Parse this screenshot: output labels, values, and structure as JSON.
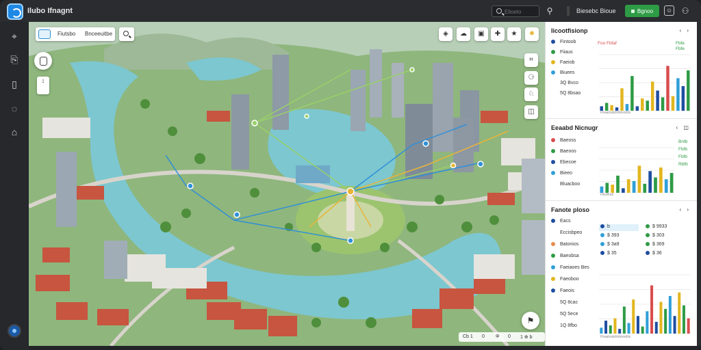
{
  "window": {
    "title": "Ilubo Ifnagnt",
    "search_placeholder": "Elioeto",
    "user": "Biesebc Bioue",
    "primary_button": "Bgnoo",
    "icons": [
      "app-logo-icon",
      "search-icon",
      "zoom-icon",
      "user-icon",
      "image-icon"
    ]
  },
  "left_rail": {
    "items": [
      "layers-icon",
      "document-icon",
      "book-icon",
      "chat-icon",
      "folder-icon"
    ]
  },
  "map": {
    "toolbar": {
      "label1": "Fiutsbo",
      "label2": "Bnceeuitbe"
    },
    "zoom_label": "1\nJ",
    "top_tools": [
      "◈",
      "☁",
      "▣",
      "✚",
      "★"
    ],
    "side_tools": [
      "⌗",
      "⚆",
      "♘",
      "◫"
    ],
    "compass": "⚑",
    "footer": [
      "Cb 1",
      "0",
      "Φ",
      "0",
      "1 ⊕ b"
    ],
    "colors": {
      "water": "#7cc7d0",
      "grass": "#7fb063",
      "road": "#d8d4cc",
      "roof": "#c7553f",
      "route_green": "#9ad06a",
      "route_yellow": "#e8b53a",
      "route_blue": "#2f8fd8"
    }
  },
  "panel": {
    "section1": {
      "title": "Iicootfisionp",
      "controls": "‹ ›",
      "rows": [
        {
          "label": "Fintoob",
          "color": "#1f4ea1"
        },
        {
          "label": "Fiiaus",
          "color": "#2e9b45"
        },
        {
          "label": "Faeiob",
          "color": "#e3b61f"
        },
        {
          "label": "Biuees",
          "color": "#2f9fd8"
        },
        {
          "label": "3Q Bvco",
          "color": ""
        },
        {
          "label": "5Q 8bsao",
          "color": ""
        }
      ],
      "tags_left": "Foo Fbfaf",
      "tags_right": "Fbfe\nFbfe",
      "bottom_axis": "Fbaalnaiidmbisndtis",
      "chart_data": {
        "type": "bar",
        "values": [
          8,
          14,
          10,
          6,
          40,
          12,
          62,
          8,
          22,
          18,
          52,
          36,
          24,
          80,
          26,
          58,
          44,
          72
        ],
        "colors": [
          "#1f4ea1",
          "#2e9b45",
          "#e3b61f",
          "#1f4ea1",
          "#e3b61f",
          "#2f9fd8",
          "#2e9b45",
          "#1f4ea1",
          "#e3b61f",
          "#2e9b45",
          "#e3b61f",
          "#1f4ea1",
          "#2e9b45",
          "#d94c4c",
          "#e3b61f",
          "#2f9fd8",
          "#1f4ea1",
          "#2e9b45"
        ],
        "ylim": [
          0,
          100
        ]
      }
    },
    "section2": {
      "title": "Eeaabd Nicnugr",
      "controls": "‹ ◫",
      "rows": [
        {
          "label": "Baeoss",
          "color": "#d94c4c"
        },
        {
          "label": "Baeoos",
          "color": "#2e9b45"
        },
        {
          "label": "Ebecoe",
          "color": "#1f4ea1"
        },
        {
          "label": "Bieeo",
          "color": "#2f9fd8"
        },
        {
          "label": "Bluacboo",
          "color": ""
        }
      ],
      "tags_right": "Bnfb\nFbfb\nFbfb\nRbfb",
      "bottom_axis": "Fibdlmdi",
      "chart_data": {
        "type": "bar",
        "values": [
          14,
          22,
          18,
          38,
          10,
          30,
          26,
          60,
          20,
          48,
          34,
          56,
          30,
          44
        ],
        "colors": [
          "#2f9fd8",
          "#2e9b45",
          "#e3b61f",
          "#2e9b45",
          "#1f4ea1",
          "#e3b61f",
          "#2f9fd8",
          "#e3b61f",
          "#2e9b45",
          "#1f4ea1",
          "#2e9b45",
          "#e3b61f",
          "#2f9fd8",
          "#2e9b45"
        ],
        "ylim": [
          0,
          100
        ]
      }
    },
    "section3": {
      "title": "Fanote ploso",
      "controls": "‹ ›",
      "rows": [
        {
          "label": "Eacs",
          "color": "#1f4ea1"
        },
        {
          "label": "Eccisbpeo",
          "color": ""
        },
        {
          "label": "Batonios",
          "color": "#e88b4a"
        },
        {
          "label": "Baeobsa",
          "color": "#2e9b45"
        },
        {
          "label": "Faeiaoes Bes",
          "color": "#2f9fd8"
        },
        {
          "label": "Faeoboo",
          "color": "#e3b61f"
        },
        {
          "label": "Faeois",
          "color": "#1f4ea1"
        },
        {
          "label": "5Q 8cac",
          "color": ""
        },
        {
          "label": "5Q 5ece",
          "color": ""
        },
        {
          "label": "1Q 8fbo",
          "color": ""
        }
      ],
      "table": [
        {
          "left": "b",
          "right": "$ 9933",
          "lc": "#1f4ea1",
          "rc": "#2e9b45"
        },
        {
          "left": "$ 393",
          "right": "$ 303",
          "lc": "#2f9fd8",
          "rc": "#2e9b45"
        },
        {
          "left": "$ 3a9",
          "right": "$ 369",
          "lc": "#2f9fd8",
          "rc": "#2e9b45"
        },
        {
          "left": "$ 35",
          "right": "$ 36",
          "lc": "#1f4ea1",
          "rc": "#1f4ea1"
        }
      ],
      "bottom_axis": "Fbaalnaiidmbisndtis",
      "chart_data": {
        "type": "bar",
        "values": [
          10,
          22,
          14,
          26,
          8,
          46,
          18,
          58,
          30,
          12,
          38,
          82,
          20,
          54,
          42,
          64,
          30,
          70,
          48,
          26
        ],
        "colors": [
          "#2f9fd8",
          "#1f4ea1",
          "#2e9b45",
          "#e3b61f",
          "#1f4ea1",
          "#2e9b45",
          "#2f9fd8",
          "#e3b61f",
          "#1f4ea1",
          "#2e9b45",
          "#2f9fd8",
          "#d94c4c",
          "#1f4ea1",
          "#e3b61f",
          "#2e9b45",
          "#2f9fd8",
          "#1f4ea1",
          "#e3b61f",
          "#2e9b45",
          "#d94c4c"
        ],
        "ylim": [
          0,
          100
        ]
      }
    }
  }
}
